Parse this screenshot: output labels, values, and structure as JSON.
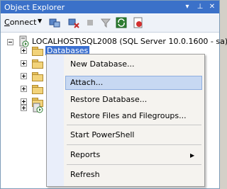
{
  "window": {
    "title": "Object Explorer",
    "title_buttons": {
      "pin": "▾",
      "auto_hide": "⊥",
      "close": "✕"
    }
  },
  "toolbar": {
    "connect_label": "onnect",
    "connect_underline": "C",
    "connect_arrow": "▼",
    "icons": [
      "connect-server-icon",
      "disconnect-icon",
      "stop-icon",
      "filter-icon",
      "refresh-icon",
      "reports-icon"
    ]
  },
  "tree": {
    "server_label": "LOCALHOST\\SQL2008 (SQL Server 10.0.1600 - sa)",
    "selected_node": "Databases"
  },
  "context_menu": {
    "items": [
      "New Database...",
      "Attach...",
      "Restore Database...",
      "Restore Files and Filegroups...",
      "Start PowerShell",
      "Reports",
      "Refresh"
    ],
    "highlighted": "Attach...",
    "submenu_arrow": "▶"
  },
  "colors": {
    "titlebar": "#3b71c9",
    "selection": "#3a6fd0",
    "menu_highlight": "#c7d8f2"
  }
}
